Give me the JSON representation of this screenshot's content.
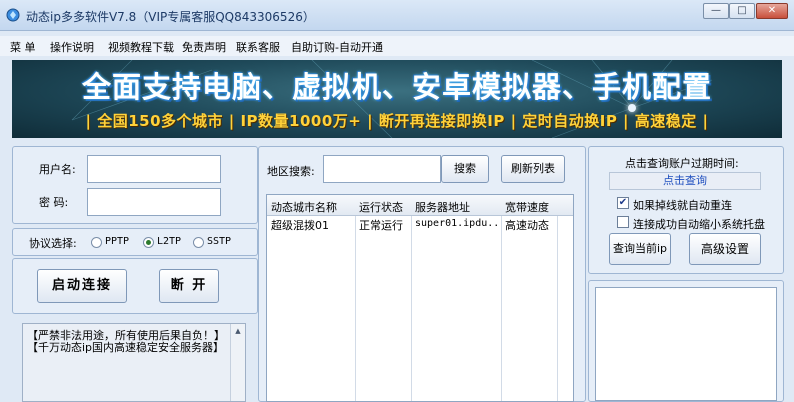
{
  "window": {
    "title": "动态ip多多软件V7.8（VIP专属客服QQ843306526）",
    "minimize": "—",
    "maximize": "□",
    "close": "✕"
  },
  "menu": [
    "菜 单",
    "操作说明",
    "视频教程下载",
    "免责声明",
    "联系客服",
    "自助订购-自动开通"
  ],
  "banner": {
    "line1": "全面支持电脑、虚拟机、安卓模拟器、手机配置",
    "line2": "| 全国150多个城市 | IP数量1000万+ | 断开再连接即换IP | 定时自动换IP | 高速稳定 |"
  },
  "login": {
    "username_label": "用户名:",
    "password_label": "密  码:",
    "username_value": "",
    "password_value": ""
  },
  "protocol": {
    "label": "协议选择:",
    "options": [
      "PPTP",
      "L2TP",
      "SSTP"
    ],
    "selected": "L2TP"
  },
  "actions": {
    "connect": "启动连接",
    "disconnect": "断 开"
  },
  "notice": {
    "lines": [
      "【严禁非法用途，所有使用后果自负！】",
      "【千万动态ip国内高速稳定安全服务器】"
    ]
  },
  "region": {
    "label": "地区搜索:",
    "search_value": "",
    "search_button": "搜索",
    "refresh_button": "刷新列表"
  },
  "table": {
    "columns": [
      "动态城市名称",
      "运行状态",
      "服务器地址",
      "宽带速度"
    ],
    "rows": [
      [
        "超级混拨01",
        "正常运行",
        "super01.ipdu...",
        "高速动态"
      ]
    ]
  },
  "right_panel": {
    "expiry_label": "点击查询账户过期时间:",
    "expiry_link": "点击查询",
    "option1": "如果掉线就自动重连",
    "option1_checked": true,
    "option2": "连接成功自动缩小系统托盘",
    "option2_checked": false,
    "query_ip_button": "查询当前ip",
    "advanced_button": "高级设置"
  },
  "colors": {
    "window_bg": "#dfe9f5",
    "banner_text": "#ffffff",
    "banner_tagline": "#ffd23a",
    "link": "#1f4fbf"
  }
}
